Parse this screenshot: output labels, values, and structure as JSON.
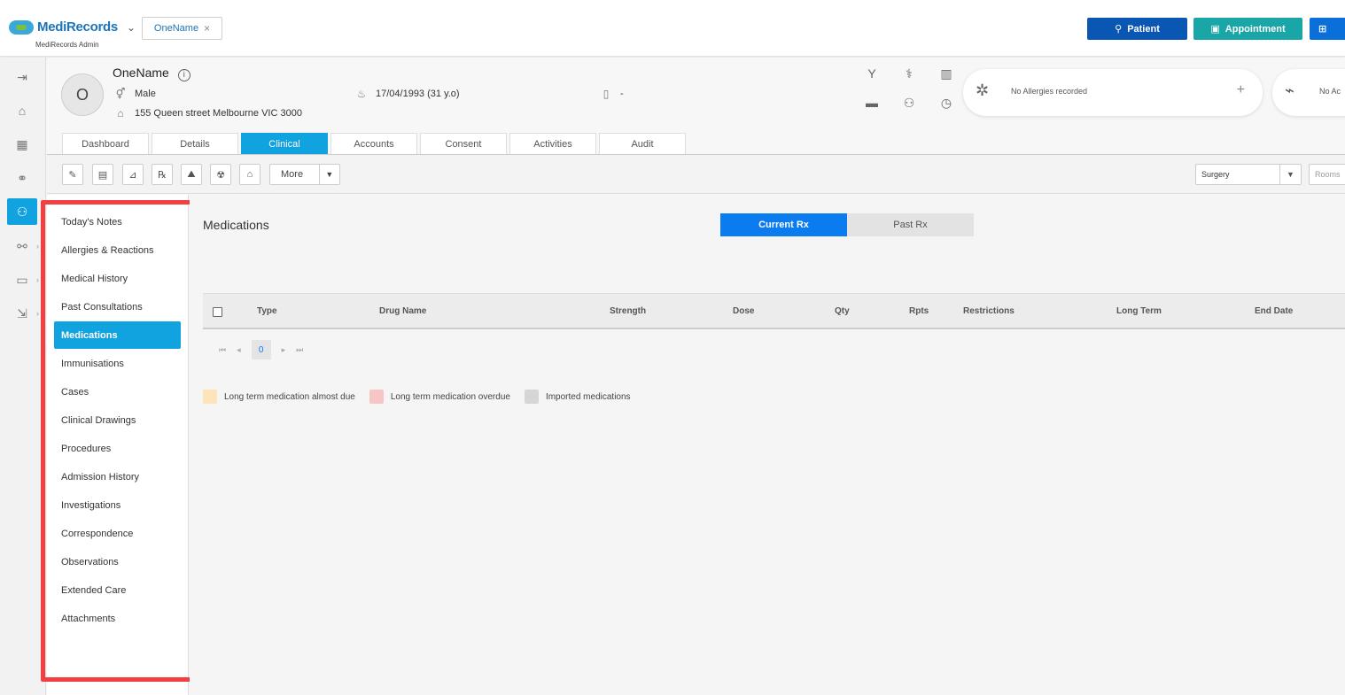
{
  "app": {
    "logo_text": "MediRecords",
    "logo_sub": "MediRecords Admin",
    "open_tab": "OneName",
    "buttons": {
      "patient": "Patient",
      "appointment": "Appointment"
    }
  },
  "patient": {
    "name": "OneName",
    "initial": "O",
    "gender": "Male",
    "address": "155 Queen street Melbourne VIC 3000",
    "dob": "17/04/1993 (31 y.o)",
    "phone": "-",
    "allergies": "No Allergies recorded",
    "alerts": "No Ac"
  },
  "tabs": [
    "Dashboard",
    "Details",
    "Clinical",
    "Accounts",
    "Consent",
    "Activities",
    "Audit"
  ],
  "active_tab": "Clinical",
  "toolbar": {
    "more": "More",
    "surgery": "Surgery",
    "rooms_placeholder": "Rooms"
  },
  "clinical_nav": [
    "Today's Notes",
    "Allergies & Reactions",
    "Medical History",
    "Past Consultations",
    "Medications",
    "Immunisations",
    "Cases",
    "Clinical Drawings",
    "Procedures",
    "Admission History",
    "Investigations",
    "Correspondence",
    "Observations",
    "Extended Care",
    "Attachments"
  ],
  "active_nav": "Medications",
  "main": {
    "title": "Medications",
    "rx_current": "Current Rx",
    "rx_past": "Past Rx",
    "columns": [
      "Type",
      "Drug Name",
      "Strength",
      "Dose",
      "Qty",
      "Rpts",
      "Restrictions",
      "Long Term",
      "End Date"
    ],
    "page": "0",
    "legend": [
      {
        "label": "Long term medication almost due",
        "color": "#fde5b8"
      },
      {
        "label": "Long term medication overdue",
        "color": "#f8c5c5"
      },
      {
        "label": "Imported medications",
        "color": "#d6d6d6"
      }
    ]
  },
  "colors": {
    "accent": "#11a3e0",
    "primary": "#0a56b3",
    "teal": "#1aa6a6",
    "highlight": "#f24040"
  }
}
